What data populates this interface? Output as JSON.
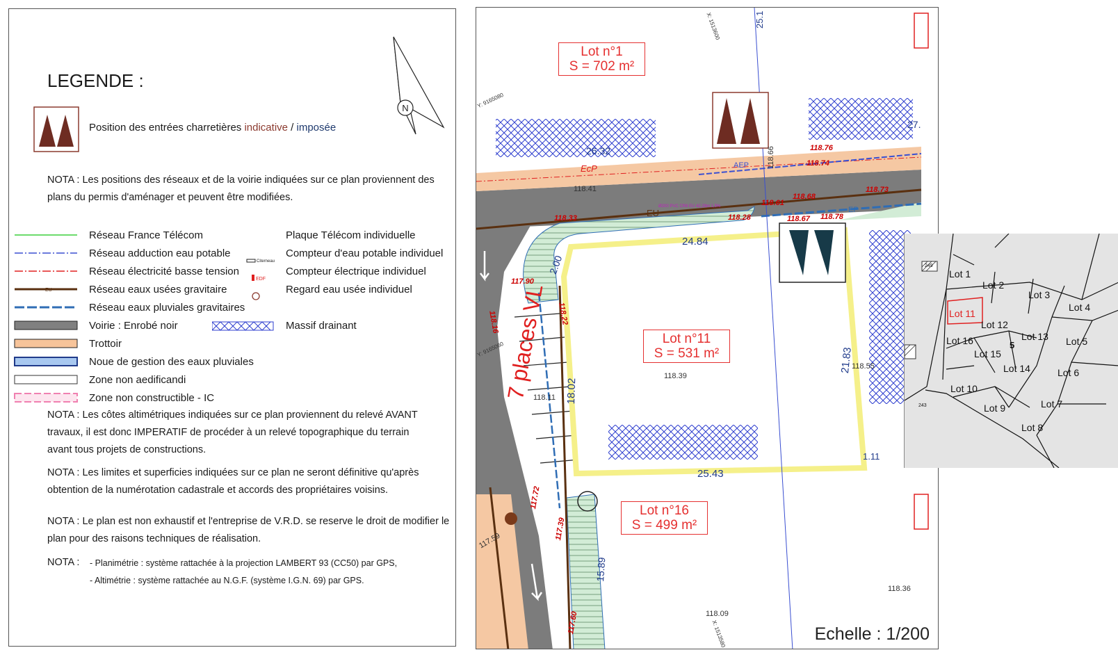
{
  "legend": {
    "title": "LEGENDE :",
    "entrances": {
      "label_prefix": "Position des entrées charretières ",
      "label_indicative": "indicative",
      "label_sep": " / ",
      "label_imposed": "imposée",
      "indicative_color": "#8b3a2f",
      "imposed_color": "#1f3a6e"
    },
    "nota_networks": "NOTA : Les positions des réseaux et de la voirie indiquées sur ce plan proviennent des plans du permis d'aménager et peuvent être modifiées.",
    "items_left": [
      {
        "label": "Réseau France Télécom",
        "color": "#3ccf3c"
      },
      {
        "label": "Réseau adduction eau potable",
        "color": "#3a4fd1"
      },
      {
        "label": "Réseau électricité basse tension",
        "color": "#e02020"
      },
      {
        "label": "Réseau eaux usées gravitaire",
        "color": "#5a3010",
        "tag": "EU"
      },
      {
        "label": "Réseau eaux pluviales gravitaires",
        "color": "#2f6db5"
      },
      {
        "label": "Voirie : Enrobé noir",
        "color": "#808080"
      },
      {
        "label": "Trottoir",
        "color": "#f7c49a"
      },
      {
        "label": "Noue de gestion des eaux pluviales",
        "color": "#2f6db5"
      },
      {
        "label": "Zone non aedificandi",
        "color": "#333333"
      },
      {
        "label": "Zone non constructible - IC",
        "color": "#f080b0"
      }
    ],
    "items_right": [
      {
        "label": "Plaque Télécom individuelle"
      },
      {
        "label": "Compteur d'eau potable individuel",
        "tag": "Citerneau"
      },
      {
        "label": "Compteur électrique individuel",
        "tag": "EDF"
      },
      {
        "label": "Regard eau usée individuel"
      },
      {
        "label": "Massif drainant",
        "color": "#2f3fcf"
      }
    ],
    "nota_altimetry_1": "NOTA : Les côtes altimétriques indiquées sur ce plan proviennent du relevé AVANT",
    "nota_altimetry_2": "travaux, il est donc IMPERATIF de procéder à un relevé topographique du terrain",
    "nota_altimetry_3": "avant tous projets de constructions.",
    "nota_limits_1": "NOTA : Les limites et superficies indiquées sur ce plan ne seront définitive qu'après",
    "nota_limits_2": "obtention de la numérotation cadastrale et accords des propriétaires voisins.",
    "nota_plan_1": "NOTA : Le plan est non exhaustif et l'entreprise de V.R.D. se reserve le droit de modifier le",
    "nota_plan_2": " plan pour des raisons techniques de réalisation.",
    "nota_systems_prefix": "NOTA :",
    "nota_systems_1": "- Planimétrie : système rattachée à la projection LAMBERT 93 (CC50) par GPS,",
    "nota_systems_2": "- Altimétrie : système rattachée au N.G.F. (système I.G.N. 69) par GPS.",
    "north_label": "N"
  },
  "plan": {
    "lot1": {
      "name": "Lot n°1",
      "area": "S = 702 m²"
    },
    "lot11": {
      "name": "Lot n°11",
      "area": "S = 531 m²"
    },
    "lot16": {
      "name": "Lot n°16",
      "area": "S = 499 m²"
    },
    "parking_label": "7 places VL",
    "scale": "Echelle : 1/200",
    "dimensions": {
      "top": "24.84",
      "bottom": "25.43",
      "left": "18.02",
      "right": "21.83",
      "d200": "2.00",
      "d2632": "26.32",
      "d1589": "15.89",
      "d111": "1.11",
      "d251": "25.1",
      "d271": "27."
    },
    "elevations": {
      "e11841": "118.41",
      "e11833": "118.33",
      "e11790": "117.90",
      "e11816": "118.16",
      "e11822": "118.22",
      "e11811": "118.11",
      "e11839": "118.39",
      "e11876": "118.76",
      "e11874": "118.74",
      "e11873": "118.73",
      "e11868": "118.68",
      "e11867": "118.67",
      "e11878": "118.78",
      "e11855": "118.55",
      "e11828": "118.28",
      "e11866": "118.66",
      "e11861": "118.61",
      "e11772": "117.72",
      "e11739": "117.39",
      "e11759": "117.59",
      "e11760": "117.60",
      "e11836": "118.36",
      "e11809": "118.09"
    },
    "coords": {
      "y1": "Y: 9165080",
      "y2": "Y: 9165060",
      "x1": "X: 1513600",
      "x2": "X: 1513580"
    },
    "network_tags": {
      "ecp": "EcP",
      "eu": "EU",
      "ep": "EP",
      "aep": "AEP"
    },
    "pvc_note": "Ø200 PVC CR8 EU 42,29m 1,5%"
  },
  "location_map": {
    "lots": [
      "Lot 1",
      "Lot 2",
      "Lot 3",
      "Lot 4",
      "Lot 5",
      "Lot 6",
      "Lot 7",
      "Lot 8",
      "Lot 9",
      "Lot 10",
      "Lot 11",
      "Lot 12",
      "Lot 13",
      "Lot 14",
      "Lot 15",
      "Lot 16"
    ],
    "parcels": [
      "249",
      "243"
    ],
    "highlight_lot": "Lot 11",
    "highlight_color": "#e02020",
    "five": "5"
  }
}
